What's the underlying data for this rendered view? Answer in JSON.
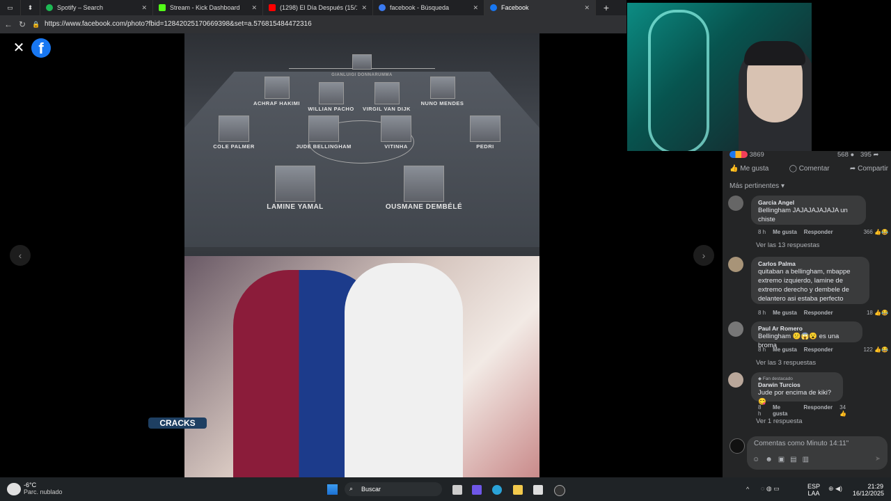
{
  "tabs": [
    {
      "title": "Spotify – Search",
      "icon": "#1db954"
    },
    {
      "title": "Stream - Kick Dashboard",
      "icon": "#53fc18"
    },
    {
      "title": "(1298) El Día Después (15/12/202…",
      "icon": "#ff0000"
    },
    {
      "title": "facebook - Búsqueda",
      "icon": "#3a7af0"
    },
    {
      "title": "Facebook",
      "icon": "#1877f2"
    }
  ],
  "address": {
    "url": "https://www.facebook.com/photo?fbid=12842025170669398&set=a.576815484472316"
  },
  "photo": {
    "players": {
      "goalkeeper": "GIANLUIGI DONNARUMMA",
      "def1": "ACHRAF HAKIMI",
      "def2": "WILLIAN PACHO",
      "def3": "VIRGIL VAN DIJK",
      "def4": "NUNO MENDES",
      "mid1": "COLE PALMER",
      "mid2": "JUDE BELLINGHAM",
      "mid3": "VITINHA",
      "mid4": "PEDRI",
      "fwd1": "LAMINE YAMAL",
      "fwd2": "OUSMANE DEMBÉLÉ"
    },
    "brand": "CRACKS"
  },
  "post": {
    "reactions": "3869",
    "comments": "568",
    "shares": "395",
    "actions": {
      "like": "Me gusta",
      "comment": "Comentar",
      "share": "Compartir"
    },
    "sort": "Más pertinentes"
  },
  "comments": [
    {
      "author": "Garcia Angel",
      "text": "Bellingham JAJAJAJAJAJA un chiste",
      "time": "8 h",
      "like": "Me gusta",
      "reply": "Responder",
      "likes": "366",
      "replies": "Ver las 13 respuestas"
    },
    {
      "author": "Carlos Palma",
      "text": "quitaban a bellingham, mbappe extremo izquierdo, lamine de extremo derecho y dembele de delantero asi estaba perfecto",
      "time": "8 h",
      "like": "Me gusta",
      "reply": "Responder",
      "likes": "18"
    },
    {
      "author": "Paul Ar Romero",
      "text": "Bellingham 😕😱😮 es una broma",
      "time": "8 h",
      "like": "Me gusta",
      "reply": "Responder",
      "likes": "122",
      "replies": "Ver las 3 respuestas"
    },
    {
      "badge": "Fan destacado",
      "author": "Darwin Turcios",
      "text": "Jude por encima de kiki? 😋",
      "time": "8 h",
      "like": "Me gusta",
      "reply": "Responder",
      "likes": "34",
      "replies": "Ver 1 respuesta"
    }
  ],
  "composer": {
    "placeholder": "Comentas como Minuto 14:11\""
  },
  "taskbar": {
    "weather": {
      "temp": "-6°C",
      "desc": "Parc. nublado"
    },
    "search": "Buscar",
    "lang": {
      "code": "ESP",
      "layout": "LAA"
    },
    "time": "21:29",
    "date": "16/12/2025"
  }
}
